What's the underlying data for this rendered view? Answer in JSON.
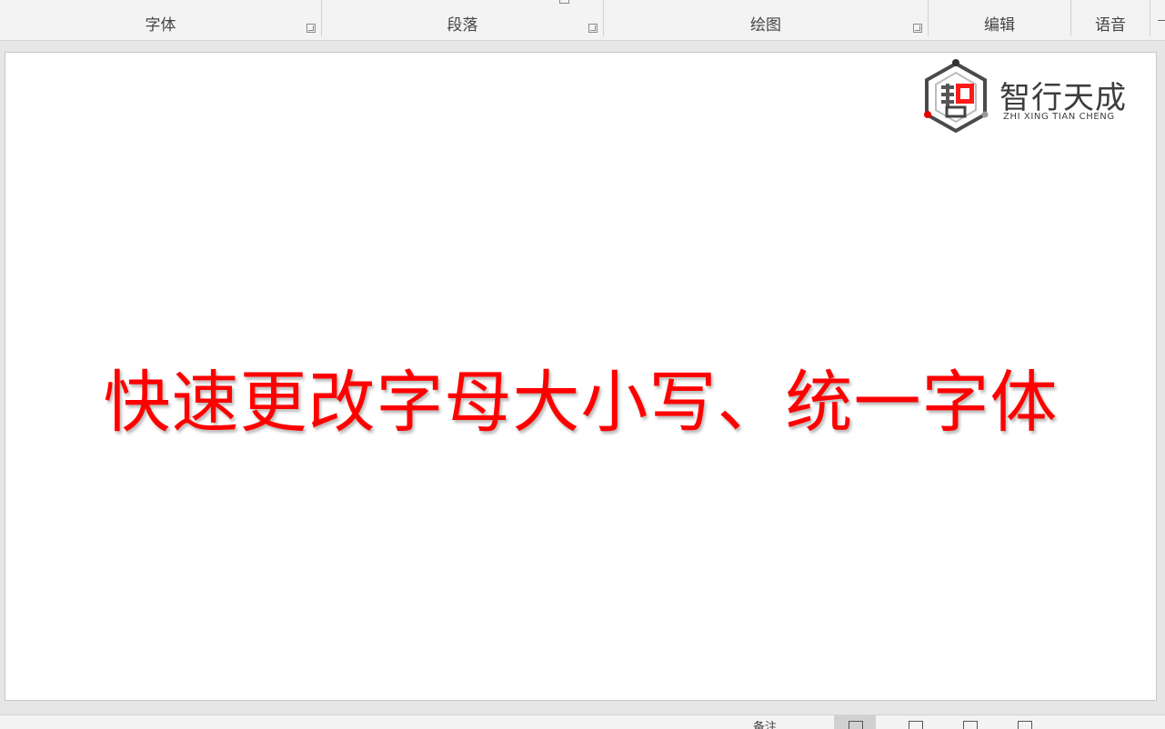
{
  "ribbon": {
    "groups": [
      {
        "label": "字体"
      },
      {
        "label": "段落"
      },
      {
        "label": "绘图"
      },
      {
        "label": "编辑"
      },
      {
        "label": "语音"
      }
    ]
  },
  "slide": {
    "title": "快速更改字母大小写、统一字体",
    "title_color": "#ff0000",
    "logo": {
      "name_cn": "智行天成",
      "name_en": "ZHI XING TIAN CHENG"
    }
  },
  "statusbar": {
    "notes_label": "备注",
    "views": [
      "normal-view-icon",
      "slide-sorter-view-icon",
      "reading-view-icon",
      "slideshow-view-icon"
    ]
  }
}
